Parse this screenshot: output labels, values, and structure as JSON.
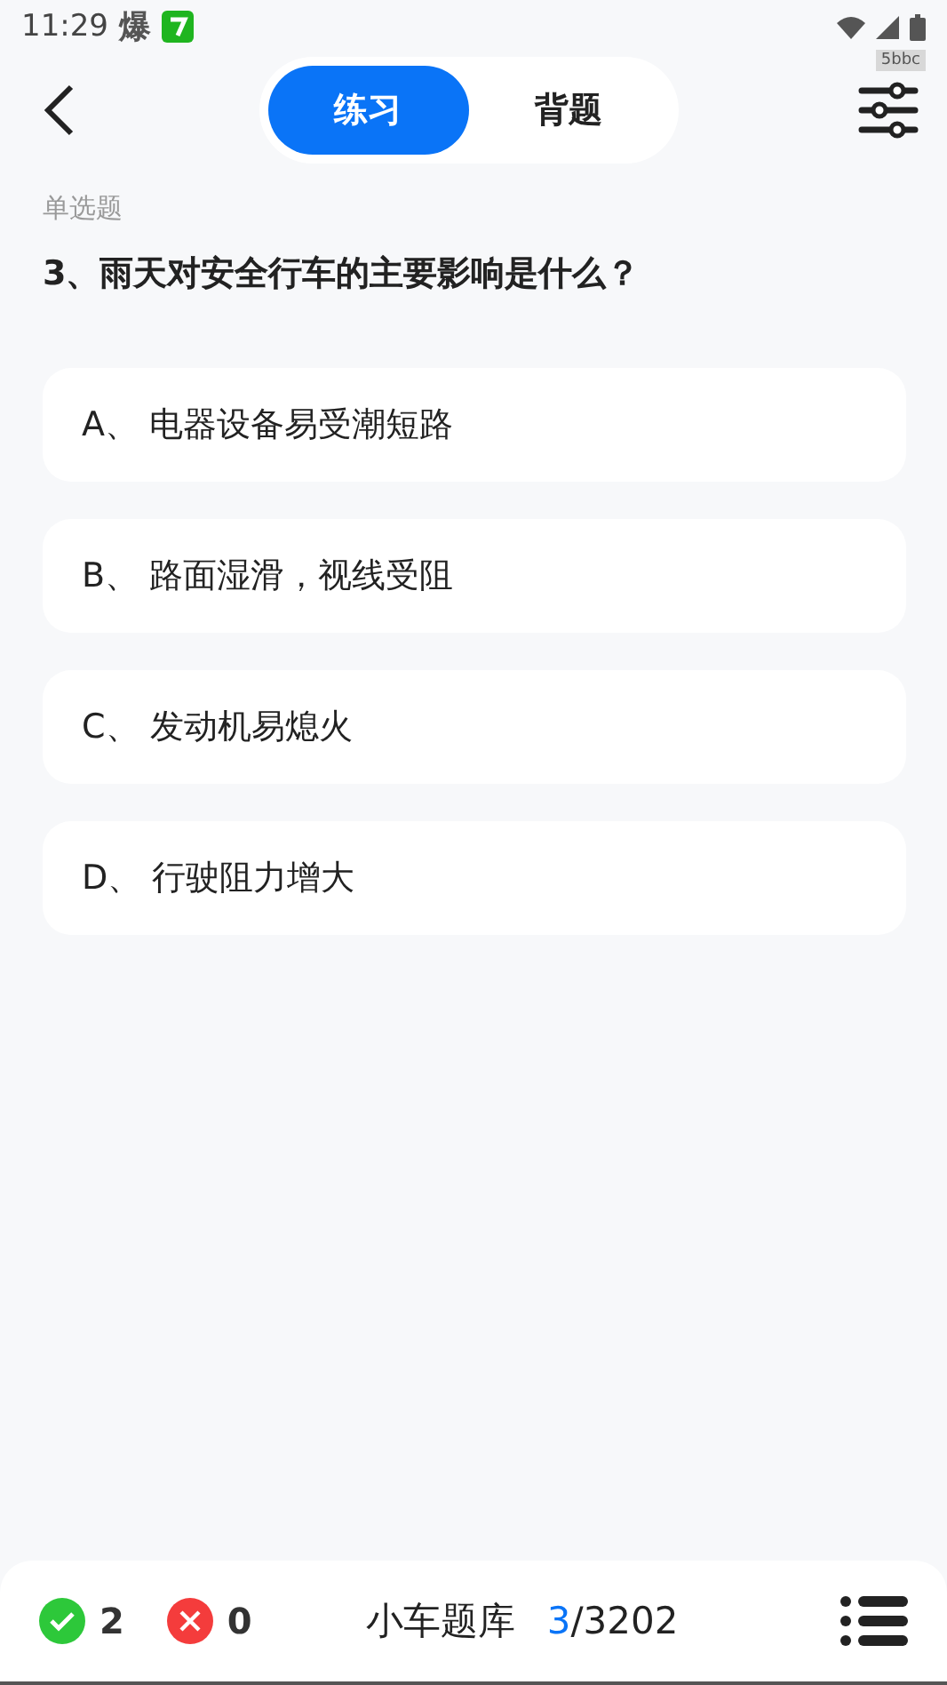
{
  "status_bar": {
    "time": "11:29",
    "notification": "爆",
    "badge_tag": "5bbc"
  },
  "tabs": [
    {
      "label": "练习",
      "selected": true
    },
    {
      "label": "背题",
      "selected": false
    }
  ],
  "question": {
    "type": "单选题",
    "text": "3、雨天对安全行车的主要影响是什么？"
  },
  "options": [
    {
      "letter": "A、",
      "text": "电器设备易受潮短路",
      "selected": false
    },
    {
      "letter": "B、",
      "text": "路面湿滑，视线受阻",
      "selected": false
    },
    {
      "letter": "C、",
      "text": "发动机易熄火",
      "selected": false
    },
    {
      "letter": "D、",
      "text": "行驶阻力增大",
      "selected": false
    }
  ],
  "footer": {
    "correct": "2",
    "wrong": "0",
    "bank": "小车题库",
    "current": "3",
    "total": "/3202"
  }
}
